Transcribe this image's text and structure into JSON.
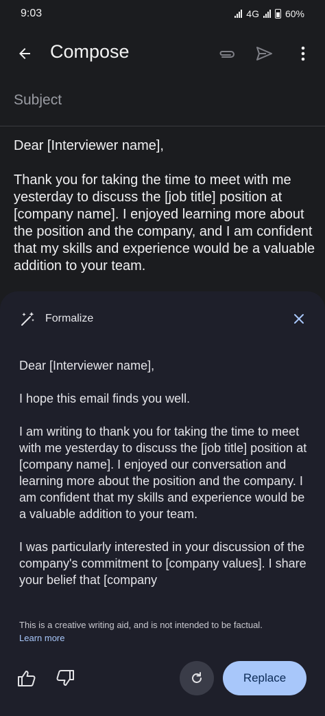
{
  "status_bar": {
    "time": "9:03",
    "network": "4G",
    "battery": "60%"
  },
  "app_bar": {
    "title": "Compose",
    "back_icon": "arrow-left-icon",
    "attach_icon": "paperclip-icon",
    "send_icon": "send-icon",
    "more_icon": "more-vert-icon"
  },
  "subject": {
    "placeholder": "Subject"
  },
  "draft": {
    "greeting": "Dear [Interviewer name],",
    "paragraph": "Thank you for taking the time to meet with me yesterday to discuss the [job title] position at [company name]. I enjoyed learning more about the position and the company, and I am confident that my skills and experience would be a valuable addition to your team."
  },
  "sheet": {
    "label": "Formalize",
    "suggestion": {
      "greeting": "Dear [Interviewer name],",
      "p1": "I hope this email finds you well.",
      "p2": "I am writing to thank you for taking the time to meet with me yesterday to discuss the [job title] position at [company name]. I enjoyed our conversation and learning more about the position and the company. I am confident that my skills and experience would be a valuable addition to your team.",
      "p3": "I was particularly interested in your discussion of the company's commitment to [company values]. I share your belief that [company"
    },
    "disclaimer": "This is a creative writing aid, and is not intended to be factual.",
    "learn_more": "Learn more",
    "replace_label": "Replace"
  },
  "colors": {
    "accent": "#a8c7fa",
    "background": "#1b1c1f",
    "sheet": "#1e1f2a"
  }
}
